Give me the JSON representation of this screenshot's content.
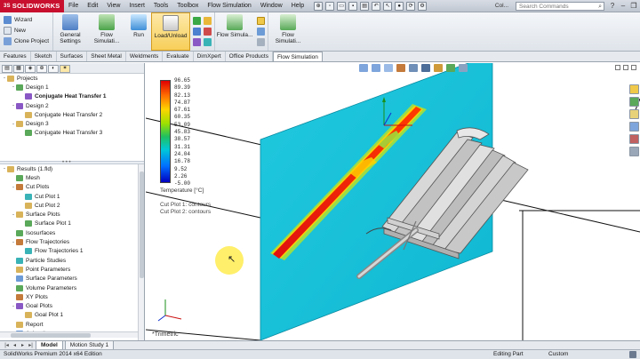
{
  "app": {
    "logo": "SOLIDWORKS",
    "menu": [
      "File",
      "Edit",
      "View",
      "Insert",
      "Tools",
      "Toolbox",
      "Flow Simulation",
      "Window",
      "Help"
    ],
    "title_fragment": "Col...",
    "search_placeholder": "Search Commands"
  },
  "ribbon": {
    "small_buttons": [
      "Wizard",
      "New",
      "Clone Project"
    ],
    "general_settings": "General Settings",
    "flow_simulation_1": "Flow Simulati...",
    "run": "Run",
    "load_unload": "Load/Unload",
    "flow_simulation_2": "Flow Simula...",
    "flow_simulation_3": "Flow Simulati..."
  },
  "tabs": [
    "Features",
    "Sketch",
    "Surfaces",
    "Sheet Metal",
    "Weldments",
    "Evaluate",
    "DimXpert",
    "Office Products",
    "Flow Simulation"
  ],
  "active_tab": "Flow Simulation",
  "project_tree": [
    {
      "label": "Projects",
      "level": 0,
      "toggle": "-",
      "bold": false
    },
    {
      "label": "Design 1",
      "level": 1,
      "toggle": "-",
      "bold": false
    },
    {
      "label": "Conjugate Heat Transfer 1",
      "level": 2,
      "toggle": "",
      "bold": true
    },
    {
      "label": "Design 2",
      "level": 1,
      "toggle": "-",
      "bold": false
    },
    {
      "label": "Conjugate Heat Transfer 2",
      "level": 2,
      "toggle": "",
      "bold": false
    },
    {
      "label": "Design 3",
      "level": 1,
      "toggle": "-",
      "bold": false
    },
    {
      "label": "Conjugate Heat Transfer 3",
      "level": 2,
      "toggle": "",
      "bold": false
    }
  ],
  "results_tree": [
    {
      "label": "Results (1.fld)",
      "level": 0,
      "toggle": "-"
    },
    {
      "label": "Mesh",
      "level": 1,
      "toggle": ""
    },
    {
      "label": "Cut Plots",
      "level": 1,
      "toggle": "-"
    },
    {
      "label": "Cut Plot 1",
      "level": 2,
      "toggle": ""
    },
    {
      "label": "Cut Plot 2",
      "level": 2,
      "toggle": ""
    },
    {
      "label": "Surface Plots",
      "level": 1,
      "toggle": "-"
    },
    {
      "label": "Surface Plot 1",
      "level": 2,
      "toggle": ""
    },
    {
      "label": "Isosurfaces",
      "level": 1,
      "toggle": ""
    },
    {
      "label": "Flow Trajectories",
      "level": 1,
      "toggle": "-"
    },
    {
      "label": "Flow Trajectories 1",
      "level": 2,
      "toggle": ""
    },
    {
      "label": "Particle Studies",
      "level": 1,
      "toggle": ""
    },
    {
      "label": "Point Parameters",
      "level": 1,
      "toggle": ""
    },
    {
      "label": "Surface Parameters",
      "level": 1,
      "toggle": ""
    },
    {
      "label": "Volume Parameters",
      "level": 1,
      "toggle": ""
    },
    {
      "label": "XY Plots",
      "level": 1,
      "toggle": ""
    },
    {
      "label": "Goal Plots",
      "level": 1,
      "toggle": "-"
    },
    {
      "label": "Goal Plot 1",
      "level": 2,
      "toggle": ""
    },
    {
      "label": "Report",
      "level": 1,
      "toggle": ""
    },
    {
      "label": "Animations",
      "level": 1,
      "toggle": ""
    }
  ],
  "legend": {
    "ticks": [
      "96.65",
      "89.39",
      "82.13",
      "74.87",
      "67.61",
      "60.35",
      "53.09",
      "45.83",
      "38.57",
      "31.31",
      "24.04",
      "16.78",
      "9.52",
      "2.26",
      "-5.00"
    ],
    "title": "Temperature [°C]",
    "notes": [
      "Cut Plot 1: contours",
      "Cut Plot 2: contours"
    ]
  },
  "view_label": "*Trimetric",
  "model_tabs": [
    "Model",
    "Motion Study 1"
  ],
  "status": {
    "edition": "SolidWorks Premium 2014 x64 Edition",
    "mode": "Editing Part",
    "units": "Custom"
  },
  "colors": {
    "logo_red": "#c8102e",
    "cut_plane": "#1cc4dc",
    "hot": "#e00000",
    "highlight": "#f7cf5a"
  }
}
